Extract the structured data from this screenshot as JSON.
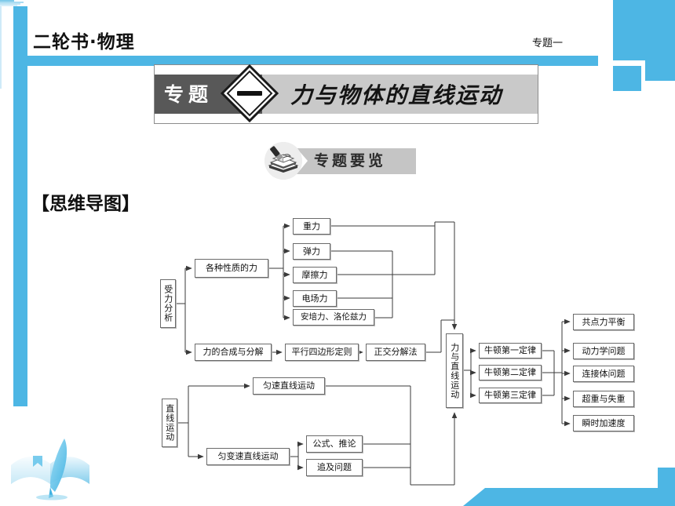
{
  "theme": {
    "accent": "#4db6e4",
    "banner_dark": "#585858",
    "banner_grey": "#c9c9c9",
    "node_border": "#6b6b6b"
  },
  "header": {
    "left_title": "二轮书·物理",
    "right_label": "专题一"
  },
  "banner": {
    "label": "专题",
    "number": "一",
    "title": "力与物体的直线运动"
  },
  "badge": {
    "icon": "books-pen-icon",
    "text": "专题要览"
  },
  "section": {
    "heading": "【思维导图】"
  },
  "chart_data": {
    "type": "diagram",
    "title": "思维导图",
    "nodes": [
      {
        "id": "n_shouli",
        "label": "受力分析",
        "vertical": true
      },
      {
        "id": "n_gezhong",
        "label": "各种性质的力",
        "vertical": false
      },
      {
        "id": "n_zhongli",
        "label": "重力",
        "vertical": false
      },
      {
        "id": "n_tanli",
        "label": "弹力",
        "vertical": false
      },
      {
        "id": "n_mocali",
        "label": "摩擦力",
        "vertical": false
      },
      {
        "id": "n_dianchang",
        "label": "电场力",
        "vertical": false
      },
      {
        "id": "n_anpei",
        "label": "安培力、洛伦兹力",
        "vertical": false
      },
      {
        "id": "n_hecheng",
        "label": "力的合成与分解",
        "vertical": false
      },
      {
        "id": "n_pingxing",
        "label": "平行四边形定则",
        "vertical": false
      },
      {
        "id": "n_zhengjiao",
        "label": "正交分解法",
        "vertical": false
      },
      {
        "id": "n_zhixian",
        "label": "直线运动",
        "vertical": true
      },
      {
        "id": "n_yunsu",
        "label": "匀速直线运动",
        "vertical": false
      },
      {
        "id": "n_yunbiansu",
        "label": "匀变速直线运动",
        "vertical": false
      },
      {
        "id": "n_gongshi",
        "label": "公式、推论",
        "vertical": false
      },
      {
        "id": "n_zhuiji",
        "label": "追及问题",
        "vertical": false
      },
      {
        "id": "n_center",
        "label": "力与直线运动",
        "vertical": true
      },
      {
        "id": "n_newton1",
        "label": "牛顿第一定律",
        "vertical": false
      },
      {
        "id": "n_newton2",
        "label": "牛顿第二定律",
        "vertical": false
      },
      {
        "id": "n_newton3",
        "label": "牛顿第三定律",
        "vertical": false
      },
      {
        "id": "n_gongdian",
        "label": "共点力平衡",
        "vertical": false
      },
      {
        "id": "n_donglixue",
        "label": "动力学问题",
        "vertical": false
      },
      {
        "id": "n_lianjie",
        "label": "连接体问题",
        "vertical": false
      },
      {
        "id": "n_chaozhong",
        "label": "超重与失重",
        "vertical": false
      },
      {
        "id": "n_shunshi",
        "label": "瞬时加速度",
        "vertical": false
      }
    ],
    "edges": [
      [
        "n_shouli",
        "n_gezhong"
      ],
      [
        "n_shouli",
        "n_hecheng"
      ],
      [
        "n_gezhong",
        "n_zhongli"
      ],
      [
        "n_gezhong",
        "n_tanli"
      ],
      [
        "n_gezhong",
        "n_mocali"
      ],
      [
        "n_gezhong",
        "n_dianchang"
      ],
      [
        "n_gezhong",
        "n_anpei"
      ],
      [
        "n_hecheng",
        "n_pingxing"
      ],
      [
        "n_pingxing",
        "n_zhengjiao"
      ],
      [
        "n_zhongli",
        "n_center"
      ],
      [
        "n_tanli",
        "n_center"
      ],
      [
        "n_mocali",
        "n_center"
      ],
      [
        "n_dianchang",
        "n_center"
      ],
      [
        "n_anpei",
        "n_center"
      ],
      [
        "n_zhengjiao",
        "n_center"
      ],
      [
        "n_zhixian",
        "n_yunsu"
      ],
      [
        "n_zhixian",
        "n_yunbiansu"
      ],
      [
        "n_yunbiansu",
        "n_gongshi"
      ],
      [
        "n_yunbiansu",
        "n_zhuiji"
      ],
      [
        "n_yunsu",
        "n_center"
      ],
      [
        "n_gongshi",
        "n_center"
      ],
      [
        "n_zhuiji",
        "n_center"
      ],
      [
        "n_center",
        "n_newton1"
      ],
      [
        "n_center",
        "n_newton2"
      ],
      [
        "n_center",
        "n_newton3"
      ],
      [
        "n_newton1",
        "n_gongdian"
      ],
      [
        "n_newton2",
        "n_donglixue"
      ],
      [
        "n_newton2",
        "n_lianjie"
      ],
      [
        "n_newton2",
        "n_chaozhong"
      ],
      [
        "n_newton3",
        "n_shunshi"
      ]
    ]
  }
}
